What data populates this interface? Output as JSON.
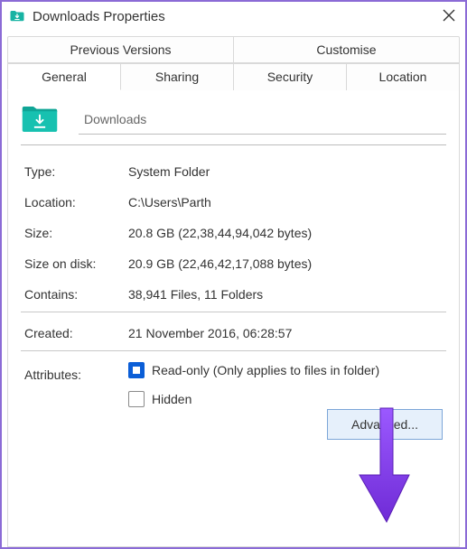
{
  "window": {
    "title": "Downloads Properties"
  },
  "tabs": {
    "row1": [
      "Previous Versions",
      "Customise"
    ],
    "row2": [
      "General",
      "Sharing",
      "Security",
      "Location"
    ],
    "active": "General"
  },
  "nameField": {
    "value": "Downloads"
  },
  "properties": {
    "typeLabel": "Type:",
    "typeValue": "System Folder",
    "locationLabel": "Location:",
    "locationValue": "C:\\Users\\Parth",
    "sizeLabel": "Size:",
    "sizeValue": "20.8 GB (22,38,44,94,042 bytes)",
    "sizeOnDiskLabel": "Size on disk:",
    "sizeOnDiskValue": "20.9 GB (22,46,42,17,088 bytes)",
    "containsLabel": "Contains:",
    "containsValue": "38,941 Files, 11 Folders",
    "createdLabel": "Created:",
    "createdValue": "21 November 2016, 06:28:57",
    "attributesLabel": "Attributes:"
  },
  "attributes": {
    "readonly": {
      "label": "Read-only (Only applies to files in folder)",
      "state": "indeterminate"
    },
    "hidden": {
      "label": "Hidden",
      "state": "unchecked"
    }
  },
  "buttons": {
    "advanced": "Advanced..."
  },
  "icons": {
    "folder": "downloads-folder-icon",
    "close": "close-icon"
  },
  "overlay": {
    "arrowColor": "#8b3dff"
  }
}
